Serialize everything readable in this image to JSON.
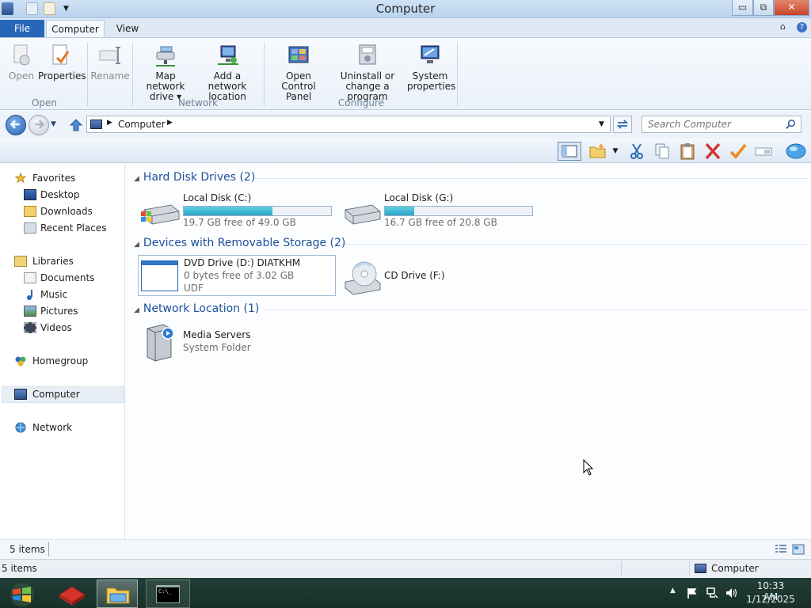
{
  "window": {
    "title": "Computer",
    "minimize": "▭",
    "maximize": "⧉",
    "close": "✕"
  },
  "ribbon": {
    "tabs": [
      "File",
      "Computer",
      "View"
    ],
    "buttons": {
      "open": "Open",
      "properties": "Properties",
      "rename": "Rename",
      "map_network_drive_1": "Map network",
      "map_network_drive_2": "drive ▾",
      "add_network_location_1": "Add a network",
      "add_network_location_2": "location",
      "open_control_panel_1": "Open Control",
      "open_control_panel_2": "Panel",
      "uninstall_1": "Uninstall or",
      "uninstall_2": "change a program",
      "system_properties_1": "System",
      "system_properties_2": "properties"
    },
    "groups": {
      "open": "Open",
      "network": "Network",
      "configure": "Configure"
    }
  },
  "address": {
    "path": "Computer",
    "search_placeholder": "Search Computer"
  },
  "nav": {
    "favorites": "Favorites",
    "desktop": "Desktop",
    "downloads": "Downloads",
    "recent_places": "Recent Places",
    "libraries": "Libraries",
    "documents": "Documents",
    "music": "Music",
    "pictures": "Pictures",
    "videos": "Videos",
    "homegroup": "Homegroup",
    "computer": "Computer",
    "network": "Network"
  },
  "content": {
    "hard_disk_header": "Hard Disk Drives (2)",
    "removable_header": "Devices with Removable Storage (2)",
    "network_header": "Network Location (1)",
    "drive_c": {
      "name": "Local Disk (C:)",
      "free": "19.7 GB free of 49.0 GB",
      "used_fraction": 0.6
    },
    "drive_g": {
      "name": "Local Disk (G:)",
      "free": "16.7 GB free of 20.8 GB",
      "used_fraction": 0.2
    },
    "drive_d": {
      "name": "DVD Drive (D:) DIATKHM",
      "free": "0 bytes free of 3.02 GB",
      "fs": "UDF"
    },
    "drive_f": {
      "name": "CD Drive (F:)"
    },
    "media_servers": {
      "name": "Media Servers",
      "type": "System Folder"
    }
  },
  "status": {
    "items": "5 items",
    "items_bottom": "5 items",
    "location": "Computer"
  },
  "taskbar": {
    "time": "10:33 AM",
    "date": "1/12/2025",
    "cmd_text": "C:\\_"
  },
  "colors": {
    "accent": "#2866b8",
    "header_text": "#1c4f99",
    "bar_fill": "#2aa4c4",
    "taskbar": "#1b362f"
  }
}
